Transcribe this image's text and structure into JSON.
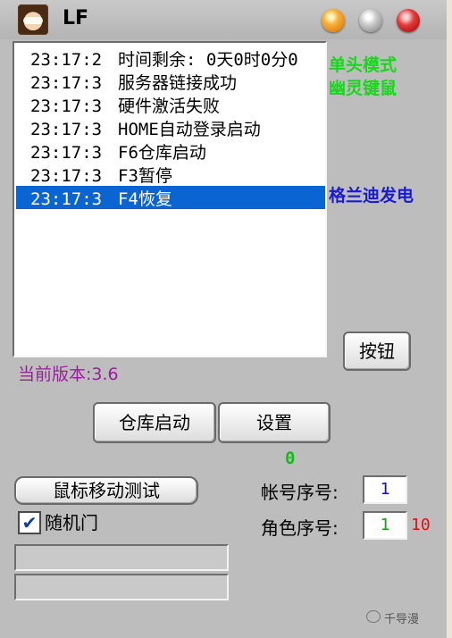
{
  "window": {
    "title": "LF",
    "controls": [
      "minimize",
      "maximize",
      "close"
    ]
  },
  "log": {
    "lines": [
      {
        "time": "23:17:2",
        "text": "时间剩余: 0天0时0分0"
      },
      {
        "time": "23:17:3",
        "text": "服务器链接成功"
      },
      {
        "time": "23:17:3",
        "text": "硬件激活失败"
      },
      {
        "time": "23:17:3",
        "text": "HOME自动登录启动"
      },
      {
        "time": "23:17:3",
        "text": "F6仓库启动"
      },
      {
        "time": "23:17:3",
        "text": "F3暂停"
      },
      {
        "time": "23:17:3",
        "text": "F4恢复"
      }
    ],
    "selected_index": 6
  },
  "side": {
    "mode_single": "单头模式",
    "mode_ghost": "幽灵键鼠",
    "server": "格兰迪发电"
  },
  "buttons": {
    "button": "按钮",
    "warehouse": "仓库启动",
    "settings": "设置",
    "mouse_test": "鼠标移动测试"
  },
  "version_label": "当前版本:3.6",
  "counter": "0",
  "fields": {
    "account_label": "帐号序号:",
    "account_value": "1",
    "role_label": "角色序号:",
    "role_value": "1",
    "role_count": "10"
  },
  "random_door": {
    "label": "随机门",
    "checked": true
  },
  "progress": [
    0,
    0
  ],
  "watermark": "千导漫",
  "colors": {
    "selection": "#0a64d2",
    "green": "#19d61c",
    "blue": "#1a1ad2",
    "purple": "#9a1f9a",
    "red": "#e01010"
  }
}
